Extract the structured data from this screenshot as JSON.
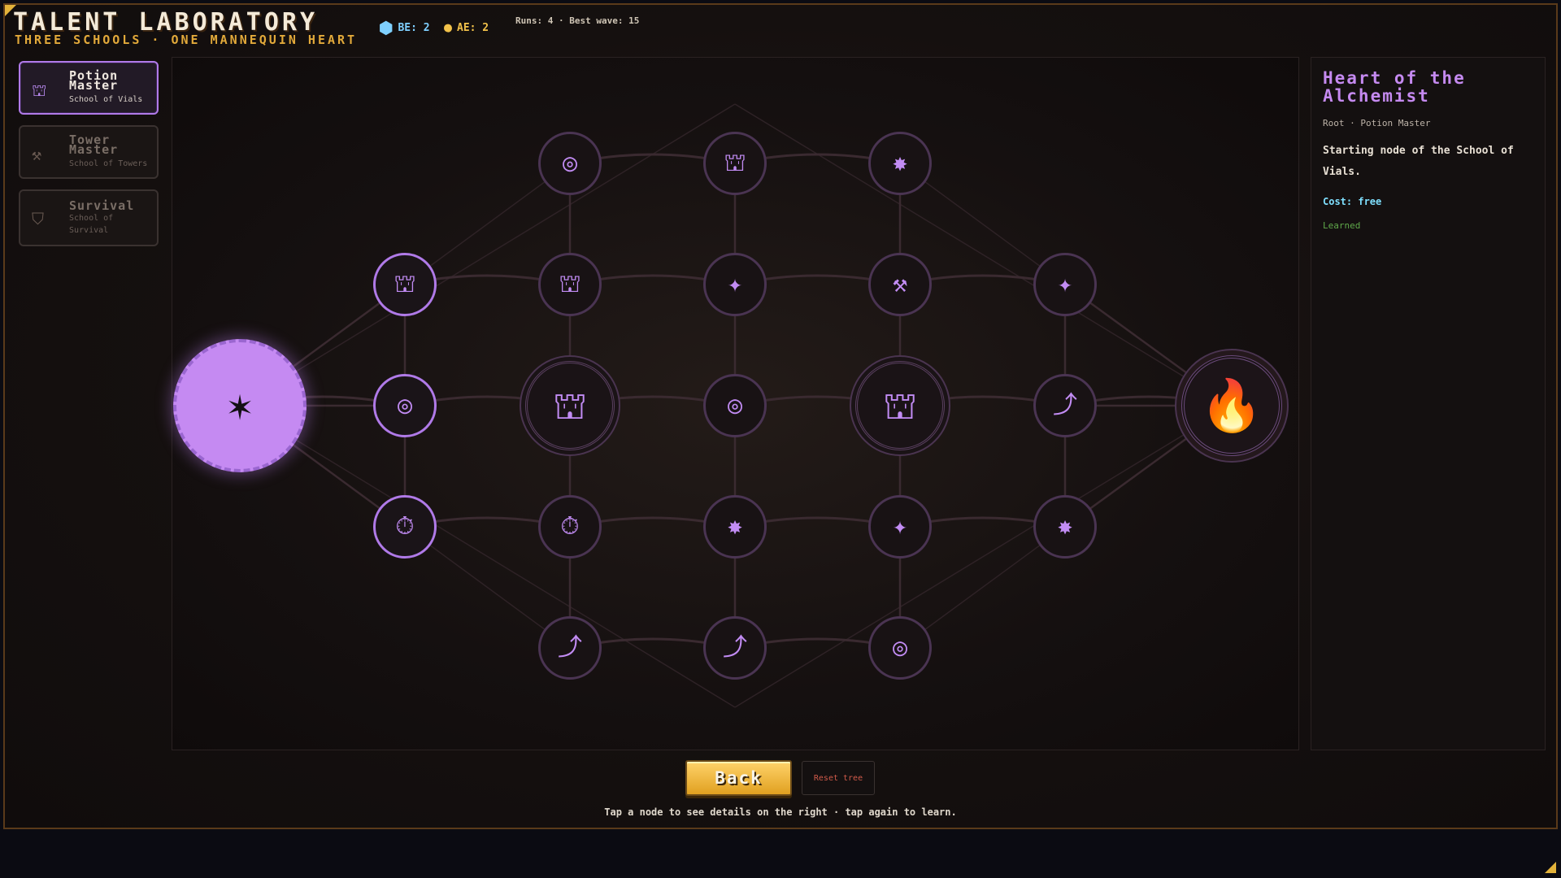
{
  "header": {
    "title": "TALENT LABORATORY",
    "subtitle": "THREE SCHOOLS · ONE MANNEQUIN HEART",
    "be_label": "BE: 2",
    "ae_label": "AE: 2",
    "stats": "Runs: 4 · Best wave: 15"
  },
  "schools": [
    {
      "name": "Potion Master",
      "sub": "School of Vials",
      "icon": "potion-icon"
    },
    {
      "name": "Tower Master",
      "sub": "School of Towers",
      "icon": "hammer-icon"
    },
    {
      "name": "Survival",
      "sub": "School of Survival",
      "icon": "shield-icon"
    }
  ],
  "details": {
    "title": "Heart of the Alchemist",
    "meta": "Root · Potion Master",
    "description": "Starting node of the School of Vials.",
    "cost": "Cost: free",
    "state": "Learned"
  },
  "buttons": {
    "back": "Back",
    "reset": "Reset tree"
  },
  "hint": "Tap a node to see details on the right · tap again to learn.",
  "colors": {
    "accent": "#c28cf4",
    "gold": "#e2a93a",
    "learned": "#5fa84a",
    "cost": "#7fe0ff"
  },
  "tree": {
    "nodes": [
      {
        "id": "root",
        "icon": "star-burst-icon",
        "state": "root",
        "col": 0,
        "row": 2
      },
      {
        "id": "n1a",
        "icon": "potion-icon",
        "state": "available",
        "col": 1,
        "row": 1
      },
      {
        "id": "n1b",
        "icon": "target-icon",
        "state": "available",
        "col": 1,
        "row": 2
      },
      {
        "id": "n1c",
        "icon": "stopwatch-icon",
        "state": "available",
        "col": 1,
        "row": 3
      },
      {
        "id": "n2t",
        "icon": "target-icon",
        "state": "locked",
        "col": 2,
        "row": 0
      },
      {
        "id": "n2a",
        "icon": "potion-icon",
        "state": "locked",
        "col": 2,
        "row": 1
      },
      {
        "id": "n2b",
        "icon": "potion-icon",
        "state": "major",
        "col": 2,
        "row": 2
      },
      {
        "id": "n2c",
        "icon": "stopwatch-icon",
        "state": "locked",
        "col": 2,
        "row": 3
      },
      {
        "id": "n2d",
        "icon": "arrow-up-icon",
        "state": "locked",
        "col": 2,
        "row": 4
      },
      {
        "id": "n3t",
        "icon": "potion-icon",
        "state": "locked",
        "col": 3,
        "row": 0
      },
      {
        "id": "n3a",
        "icon": "sparkle-icon",
        "state": "locked",
        "col": 3,
        "row": 1
      },
      {
        "id": "n3b",
        "icon": "target-icon",
        "state": "locked",
        "col": 3,
        "row": 2
      },
      {
        "id": "n3c",
        "icon": "burst-icon",
        "state": "locked",
        "col": 3,
        "row": 3
      },
      {
        "id": "n3d",
        "icon": "arrow-up-icon",
        "state": "locked",
        "col": 3,
        "row": 4
      },
      {
        "id": "n4t",
        "icon": "burst-icon",
        "state": "locked",
        "col": 4,
        "row": 0
      },
      {
        "id": "n4a",
        "icon": "hammer-icon",
        "state": "locked",
        "col": 4,
        "row": 1
      },
      {
        "id": "n4b",
        "icon": "potion-icon",
        "state": "major",
        "col": 4,
        "row": 2
      },
      {
        "id": "n4c",
        "icon": "sparkle-icon",
        "state": "locked",
        "col": 4,
        "row": 3
      },
      {
        "id": "n4d",
        "icon": "target-icon",
        "state": "locked",
        "col": 4,
        "row": 4
      },
      {
        "id": "n5a",
        "icon": "sparkle-icon",
        "state": "locked",
        "col": 5,
        "row": 1
      },
      {
        "id": "n5b",
        "icon": "arrow-up-icon",
        "state": "locked",
        "col": 5,
        "row": 2
      },
      {
        "id": "n5c",
        "icon": "burst-icon",
        "state": "locked",
        "col": 5,
        "row": 3
      },
      {
        "id": "cap",
        "icon": "flame-icon",
        "state": "capstone",
        "col": 6,
        "row": 2
      }
    ]
  }
}
